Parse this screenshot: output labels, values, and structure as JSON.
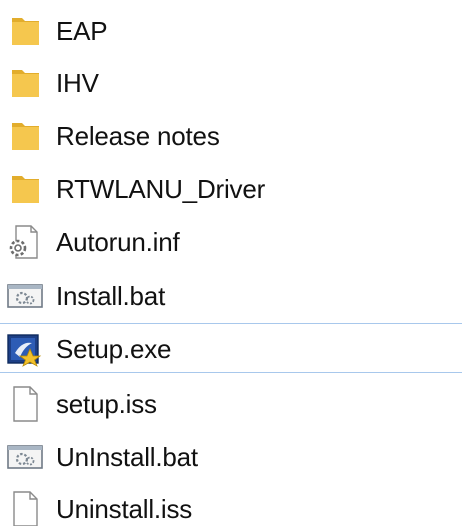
{
  "files": [
    {
      "name": "EAP",
      "icon": "folder-icon",
      "type": "folder"
    },
    {
      "name": "IHV",
      "icon": "folder-icon",
      "type": "folder"
    },
    {
      "name": "Release notes",
      "icon": "folder-icon",
      "type": "folder"
    },
    {
      "name": "RTWLANU_Driver",
      "icon": "folder-icon",
      "type": "folder"
    },
    {
      "name": "Autorun.inf",
      "icon": "settings-file-icon",
      "type": "inf"
    },
    {
      "name": "Install.bat",
      "icon": "batch-file-icon",
      "type": "bat"
    },
    {
      "name": "Setup.exe",
      "icon": "setup-exe-icon",
      "type": "exe",
      "selected": true
    },
    {
      "name": "setup.iss",
      "icon": "blank-file-icon",
      "type": "iss"
    },
    {
      "name": "UnInstall.bat",
      "icon": "batch-file-icon",
      "type": "bat"
    },
    {
      "name": "Uninstall.iss",
      "icon": "blank-file-icon",
      "type": "iss"
    }
  ],
  "colors": {
    "folder": "#f5c74e",
    "folder_dark": "#e2ad2c",
    "selection_border": "#a8c8ec",
    "text": "#111111"
  }
}
